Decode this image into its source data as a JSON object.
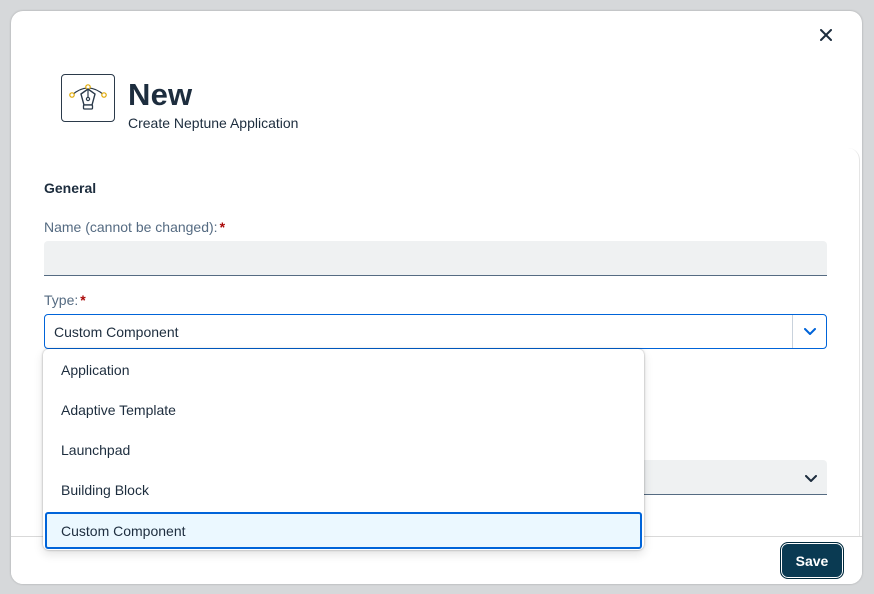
{
  "dialog": {
    "title": "New",
    "subtitle": "Create Neptune Application"
  },
  "form": {
    "section_title": "General",
    "name": {
      "label": "Name (cannot be changed):",
      "required": "*",
      "value": ""
    },
    "type": {
      "label": "Type:",
      "required": "*",
      "selected_value": "Custom Component",
      "options": [
        "Application",
        "Adaptive Template",
        "Launchpad",
        "Building Block",
        "Custom Component"
      ]
    }
  },
  "footer": {
    "save_label": "Save"
  },
  "colors": {
    "accent": "#0064d9",
    "save_button_bg": "#0a3a52",
    "required_marker": "#aa0808"
  },
  "icons": {
    "close": "close-icon",
    "header": "pen-tool-icon",
    "dropdown_arrow": "chevron-down-icon"
  }
}
